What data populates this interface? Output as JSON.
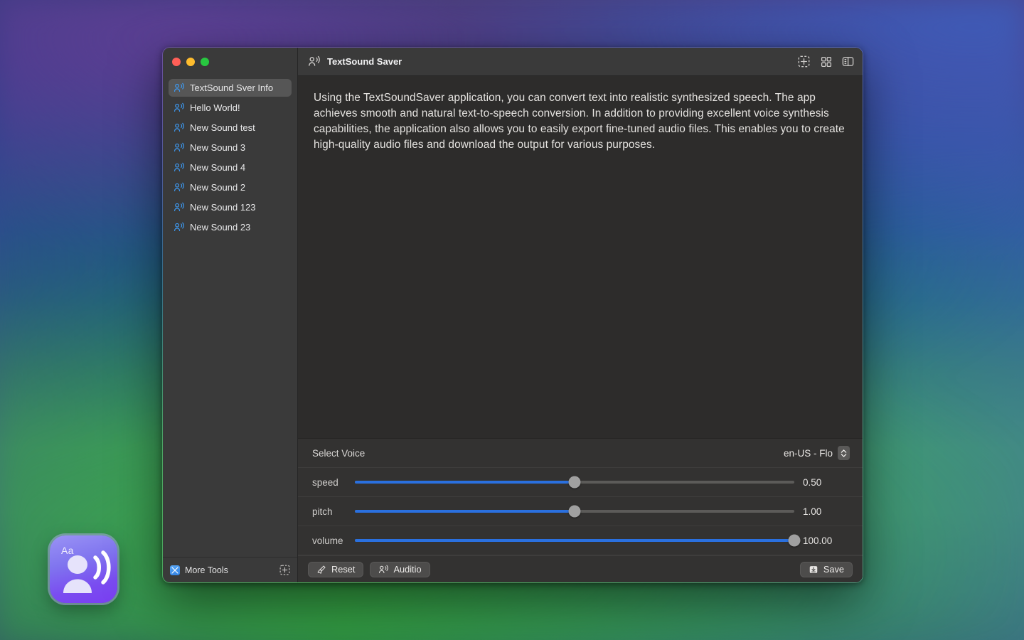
{
  "window": {
    "title": "TextSound Saver",
    "title_icon": "person-speaking-icon"
  },
  "traffic_lights": {
    "close": "close-button",
    "minimize": "minimize-button",
    "maximize": "maximize-button",
    "colors": {
      "close": "#ff5f57",
      "minimize": "#febc2e",
      "maximize": "#28c840"
    }
  },
  "toolbar": {
    "buttons": [
      {
        "name": "add-item-button",
        "icon": "dashed-square-plus-icon"
      },
      {
        "name": "gallery-view-button",
        "icon": "grid-icon"
      },
      {
        "name": "toggle-sidebar-button",
        "icon": "sidebar-icon"
      }
    ]
  },
  "sidebar": {
    "items": [
      {
        "label": "TextSound Sver Info",
        "icon": "person-speaking-icon",
        "selected": true
      },
      {
        "label": "Hello World!",
        "icon": "person-speaking-icon",
        "selected": false
      },
      {
        "label": "New Sound test",
        "icon": "person-speaking-icon",
        "selected": false
      },
      {
        "label": "New Sound 3",
        "icon": "person-speaking-icon",
        "selected": false
      },
      {
        "label": "New Sound 4",
        "icon": "person-speaking-icon",
        "selected": false
      },
      {
        "label": "New Sound 2",
        "icon": "person-speaking-icon",
        "selected": false
      },
      {
        "label": "New Sound 123",
        "icon": "person-speaking-icon",
        "selected": false
      },
      {
        "label": "New Sound 23",
        "icon": "person-speaking-icon",
        "selected": false
      }
    ],
    "footer": {
      "label": "More Tools",
      "app_icon": "app-grid-icon",
      "add_icon": "dashed-square-plus-icon"
    }
  },
  "document": {
    "body": "Using the TextSoundSaver application, you can convert text into realistic synthesized speech. The app achieves smooth and natural text-to-speech conversion. In addition to providing excellent voice synthesis capabilities, the application also allows you to easily export fine-tuned audio files. This enables you to create high-quality audio files and download the output for various purposes."
  },
  "controls": {
    "voice": {
      "label": "Select Voice",
      "value": "en-US - Flo",
      "stepper_icon": "chevron-up-down-icon"
    },
    "sliders": [
      {
        "label": "speed",
        "value": "0.50",
        "percent": 50
      },
      {
        "label": "pitch",
        "value": "1.00",
        "percent": 50
      },
      {
        "label": "volume",
        "value": "100.00",
        "percent": 100
      }
    ]
  },
  "actions": {
    "reset": {
      "label": "Reset",
      "icon": "brush-icon"
    },
    "audition": {
      "label": "Auditio",
      "icon": "person-speaking-icon"
    },
    "save": {
      "label": "Save",
      "icon": "save-download-icon"
    }
  },
  "dock": {
    "app_icon": {
      "name": "textsound-saver-app-icon",
      "badge_text": "Aa"
    }
  },
  "colors": {
    "accent": "#2a70df",
    "window_bg": "#2d2c2b",
    "sidebar_bg": "#3a3a3a",
    "titlebar_bg": "#3a3a3a"
  }
}
